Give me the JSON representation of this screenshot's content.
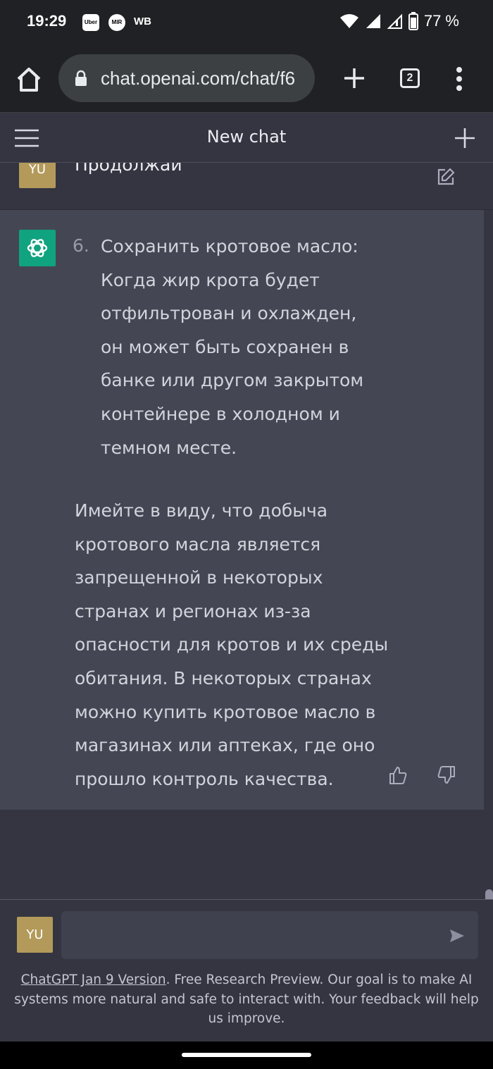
{
  "status_bar": {
    "time": "19:29",
    "apps": [
      "Uber",
      "MIR"
    ],
    "wb_label": "WB",
    "battery_percent": "77 %"
  },
  "browser": {
    "url": "chat.openai.com/chat/f6",
    "tab_count": "2"
  },
  "chat": {
    "title": "New chat",
    "user_message": "Продолжай",
    "user_initials": "YU",
    "assistant": {
      "list_number": "6.",
      "list_text": "Сохранить кротовое масло: Когда жир крота будет отфильтрован и охлажден, он может быть сохранен в банке или другом закрытом контейнере в холодном и темном месте.",
      "paragraph": "Имейте в виду, что добыча кротового масла является запрещенной в некоторых странах и регионах из-за опасности для кротов и их среды обитания. В некоторых странах можно купить кротовое масло в магазинах или аптеках, где оно прошло контроль качества."
    }
  },
  "input": {
    "user_initials": "YU",
    "value": ""
  },
  "footer": {
    "link_text": "ChatGPT Jan 9 Version",
    "text": ". Free Research Preview. Our goal is to make AI systems more natural and safe to interact with. Your feedback will help us improve."
  },
  "colors": {
    "background": "#343541",
    "assistant_bg": "#444654",
    "gpt_green": "#10a37f",
    "user_avatar": "#b39a5a"
  }
}
